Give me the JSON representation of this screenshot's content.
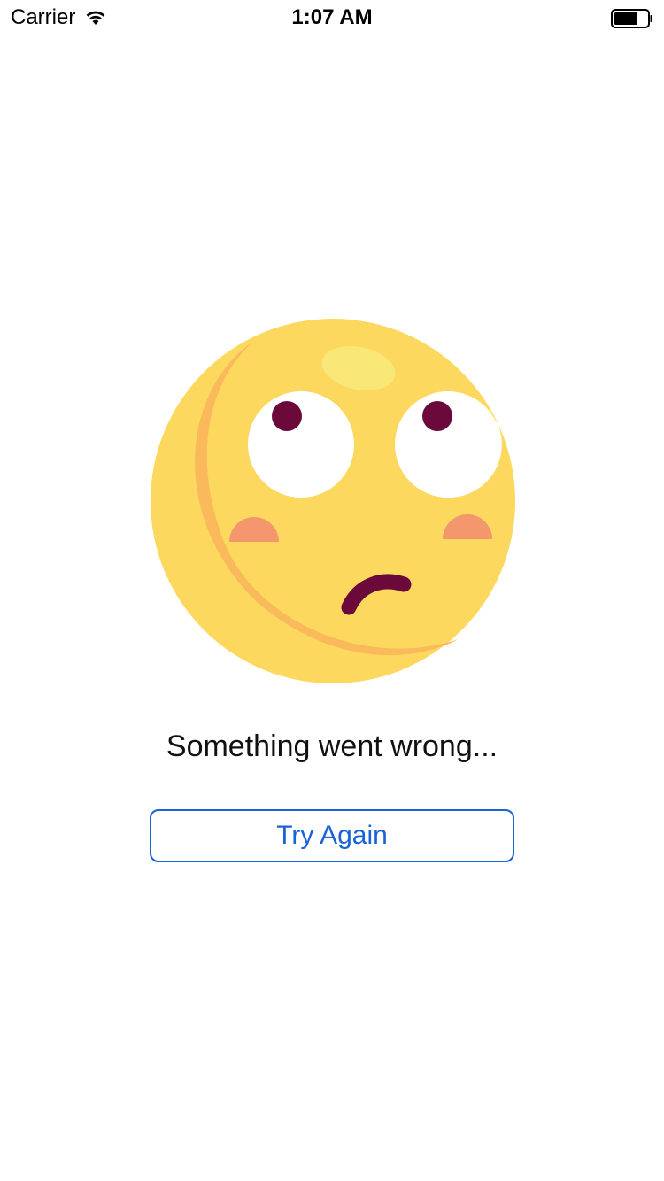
{
  "status_bar": {
    "carrier": "Carrier",
    "time": "1:07 AM",
    "wifi_icon": "wifi-icon",
    "battery_icon": "battery-icon"
  },
  "error": {
    "illustration_icon": "confused-face-icon",
    "message": "Something went wrong...",
    "retry_label": "Try Again"
  },
  "colors": {
    "accent": "#1a63d6",
    "face": "#fcd85f",
    "face_shadow": "#fab95b",
    "eye_pupil": "#6b0a3a",
    "cheek": "#f4976c",
    "highlight": "#f9e777"
  }
}
